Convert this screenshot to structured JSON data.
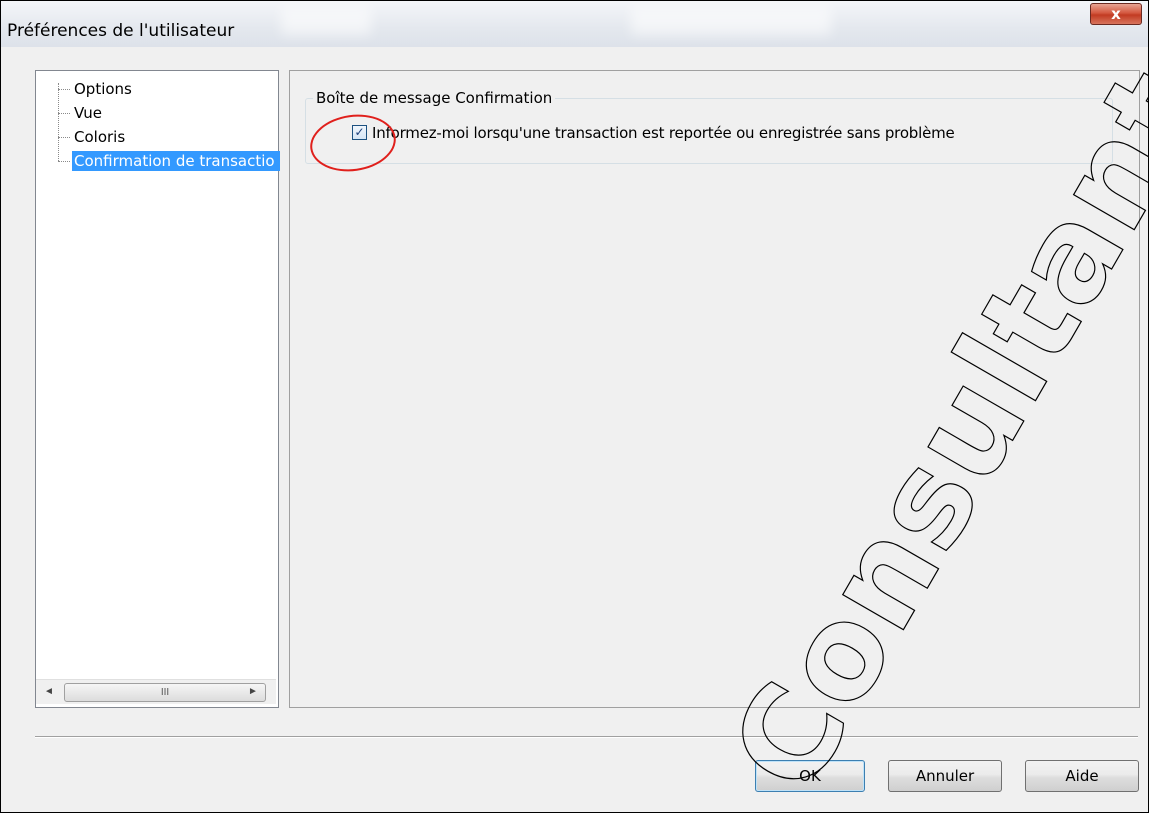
{
  "window": {
    "title": "Préférences de l'utilisateur",
    "close_symbol": "x"
  },
  "tree": {
    "items": [
      {
        "label": "Options",
        "selected": false
      },
      {
        "label": "Vue",
        "selected": false
      },
      {
        "label": "Coloris",
        "selected": false
      },
      {
        "label": "Confirmation de transactio",
        "selected": true
      }
    ],
    "scrollbar": {
      "left_arrow": "◄",
      "thumb_grip": "III",
      "right_arrow": "►"
    }
  },
  "group": {
    "legend": "Boîte de message Confirmation",
    "checkbox": {
      "checked": true,
      "label": "Informez-moi lorsqu'une transaction est reportée ou enregistrée sans problème"
    }
  },
  "buttons": {
    "ok": "OK",
    "cancel": "Annuler",
    "help": "Aide"
  },
  "watermark": {
    "text": "Consultants"
  },
  "colors": {
    "selection": "#3399ff",
    "annotation_circle": "#e0201c",
    "close_button": "#c23b22"
  }
}
